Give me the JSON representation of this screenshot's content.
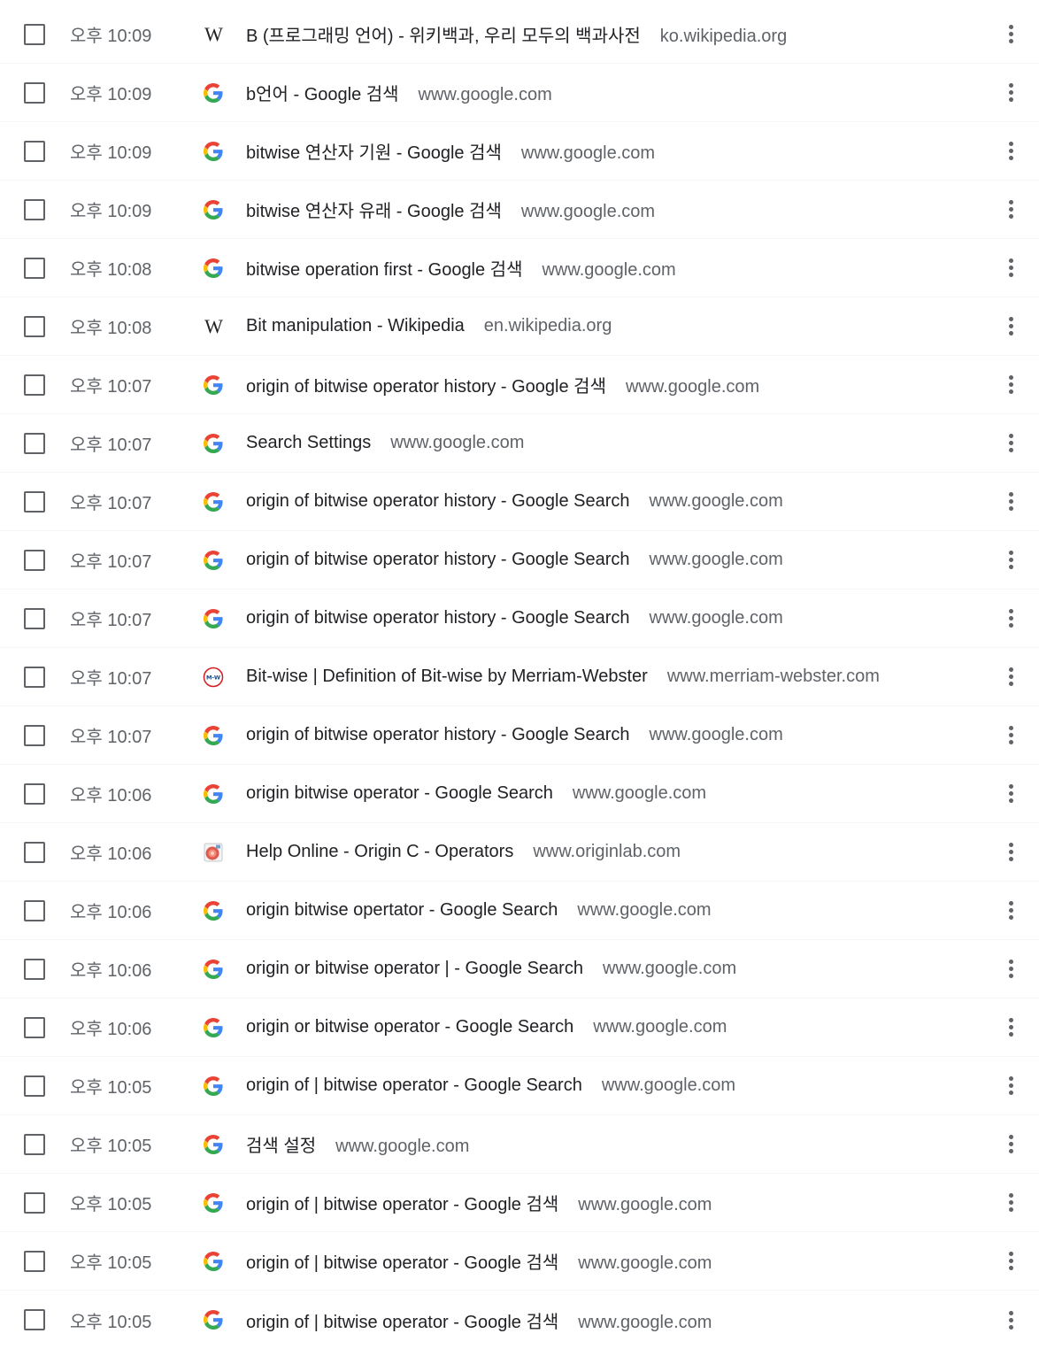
{
  "history": {
    "items": [
      {
        "time": "오후 10:09",
        "icon": "wikipedia-icon",
        "title": "B (프로그래밍 언어) - 위키백과, 우리 모두의 백과사전",
        "domain": "ko.wikipedia.org"
      },
      {
        "time": "오후 10:09",
        "icon": "google-icon",
        "title": "b언어 - Google 검색",
        "domain": "www.google.com"
      },
      {
        "time": "오후 10:09",
        "icon": "google-icon",
        "title": "bitwise 연산자 기원 - Google 검색",
        "domain": "www.google.com"
      },
      {
        "time": "오후 10:09",
        "icon": "google-icon",
        "title": "bitwise 연산자 유래 - Google 검색",
        "domain": "www.google.com"
      },
      {
        "time": "오후 10:08",
        "icon": "google-icon",
        "title": "bitwise operation first - Google 검색",
        "domain": "www.google.com"
      },
      {
        "time": "오후 10:08",
        "icon": "wikipedia-icon",
        "title": "Bit manipulation - Wikipedia",
        "domain": "en.wikipedia.org"
      },
      {
        "time": "오후 10:07",
        "icon": "google-icon",
        "title": "origin of bitwise operator history - Google 검색",
        "domain": "www.google.com"
      },
      {
        "time": "오후 10:07",
        "icon": "google-icon",
        "title": "Search Settings",
        "domain": "www.google.com"
      },
      {
        "time": "오후 10:07",
        "icon": "google-icon",
        "title": "origin of bitwise operator history - Google Search",
        "domain": "www.google.com"
      },
      {
        "time": "오후 10:07",
        "icon": "google-icon",
        "title": "origin of bitwise operator history - Google Search",
        "domain": "www.google.com"
      },
      {
        "time": "오후 10:07",
        "icon": "google-icon",
        "title": "origin of bitwise operator history - Google Search",
        "domain": "www.google.com"
      },
      {
        "time": "오후 10:07",
        "icon": "merriam-webster-icon",
        "title": "Bit-wise | Definition of Bit-wise by Merriam-Webster",
        "domain": "www.merriam-webster.com"
      },
      {
        "time": "오후 10:07",
        "icon": "google-icon",
        "title": "origin of bitwise operator history - Google Search",
        "domain": "www.google.com"
      },
      {
        "time": "오후 10:06",
        "icon": "google-icon",
        "title": "origin bitwise operator - Google Search",
        "domain": "www.google.com"
      },
      {
        "time": "오후 10:06",
        "icon": "originlab-icon",
        "title": "Help Online - Origin C - Operators",
        "domain": "www.originlab.com"
      },
      {
        "time": "오후 10:06",
        "icon": "google-icon",
        "title": "origin bitwise opertator - Google Search",
        "domain": "www.google.com"
      },
      {
        "time": "오후 10:06",
        "icon": "google-icon",
        "title": "origin or bitwise operator | - Google Search",
        "domain": "www.google.com"
      },
      {
        "time": "오후 10:06",
        "icon": "google-icon",
        "title": "origin or bitwise operator - Google Search",
        "domain": "www.google.com"
      },
      {
        "time": "오후 10:05",
        "icon": "google-icon",
        "title": "origin of | bitwise operator - Google Search",
        "domain": "www.google.com"
      },
      {
        "time": "오후 10:05",
        "icon": "google-icon",
        "title": "검색 설정",
        "domain": "www.google.com"
      },
      {
        "time": "오후 10:05",
        "icon": "google-icon",
        "title": "origin of | bitwise operator - Google 검색",
        "domain": "www.google.com"
      },
      {
        "time": "오후 10:05",
        "icon": "google-icon",
        "title": "origin of | bitwise operator - Google 검색",
        "domain": "www.google.com"
      },
      {
        "time": "오후 10:05",
        "icon": "google-icon",
        "title": "origin of | bitwise operator - Google 검색",
        "domain": "www.google.com"
      }
    ]
  },
  "icon_text": {
    "wikipedia": "W",
    "merriam_webster": "M-W"
  },
  "colors": {
    "google_blue": "#4285F4",
    "google_red": "#EA4335",
    "google_yellow": "#FBBC05",
    "google_green": "#34A853",
    "mw_red": "#d71920",
    "text_primary": "#202124",
    "text_secondary": "#5f6368"
  }
}
